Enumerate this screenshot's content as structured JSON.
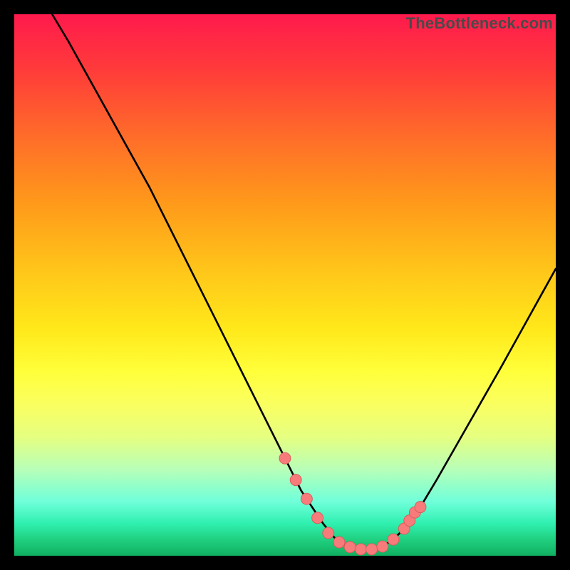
{
  "watermark": "TheBottleneck.com",
  "colors": {
    "curve_stroke": "#000000",
    "marker_fill": "#f77b7b",
    "marker_stroke": "#d85a5a",
    "background_frame": "#000000"
  },
  "chart_data": {
    "type": "line",
    "title": "",
    "xlabel": "",
    "ylabel": "",
    "xlim": [
      0,
      100
    ],
    "ylim": [
      0,
      100
    ],
    "series": [
      {
        "name": "bottleneck-curve",
        "x": [
          7,
          10,
          15,
          20,
          25,
          30,
          35,
          40,
          45,
          50,
          53,
          55,
          57,
          59,
          60,
          62,
          64,
          66,
          68,
          70,
          72,
          75,
          78,
          82,
          86,
          90,
          95,
          100
        ],
        "y": [
          100,
          95,
          86,
          77,
          68,
          58,
          48,
          38,
          28,
          18,
          12,
          9,
          6,
          3.5,
          2.5,
          1.6,
          1.2,
          1.2,
          1.7,
          3,
          5,
          9,
          14,
          21,
          28,
          35,
          44,
          53
        ]
      }
    ],
    "markers": {
      "name": "highlight-points",
      "x": [
        50,
        52,
        54,
        56,
        58,
        60,
        62,
        64,
        66,
        68,
        70,
        72,
        73,
        74,
        75
      ],
      "y": [
        18,
        14,
        10.5,
        7,
        4.2,
        2.5,
        1.6,
        1.2,
        1.2,
        1.7,
        3,
        5,
        6.5,
        8,
        9
      ]
    }
  }
}
